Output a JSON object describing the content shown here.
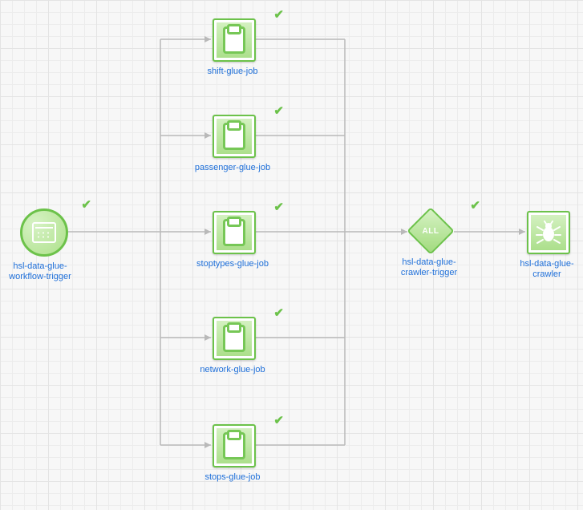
{
  "colors": {
    "accent": "#6cc24a",
    "link": "#1e6fd9"
  },
  "nodes": {
    "trigger": {
      "type": "schedule",
      "label": "hsl-data-glue-workflow-trigger",
      "status": "succeeded"
    },
    "jobs": [
      {
        "label": "shift-glue-job",
        "status": "succeeded"
      },
      {
        "label": "passenger-glue-job",
        "status": "succeeded"
      },
      {
        "label": "stoptypes-glue-job",
        "status": "succeeded"
      },
      {
        "label": "network-glue-job",
        "status": "succeeded"
      },
      {
        "label": "stops-glue-job",
        "status": "succeeded"
      }
    ],
    "crawler_trigger": {
      "type": "conditional",
      "badge": "ALL",
      "label": "hsl-data-glue-crawler-trigger",
      "status": "succeeded"
    },
    "crawler": {
      "type": "crawler",
      "label": "hsl-data-glue-crawler",
      "status": "succeeded"
    }
  },
  "edges": [
    {
      "from": "trigger",
      "to": "jobs.0"
    },
    {
      "from": "trigger",
      "to": "jobs.1"
    },
    {
      "from": "trigger",
      "to": "jobs.2"
    },
    {
      "from": "trigger",
      "to": "jobs.3"
    },
    {
      "from": "trigger",
      "to": "jobs.4"
    },
    {
      "from": "jobs.0",
      "to": "crawler_trigger"
    },
    {
      "from": "jobs.1",
      "to": "crawler_trigger"
    },
    {
      "from": "jobs.2",
      "to": "crawler_trigger"
    },
    {
      "from": "jobs.3",
      "to": "crawler_trigger"
    },
    {
      "from": "jobs.4",
      "to": "crawler_trigger"
    },
    {
      "from": "crawler_trigger",
      "to": "crawler"
    }
  ]
}
